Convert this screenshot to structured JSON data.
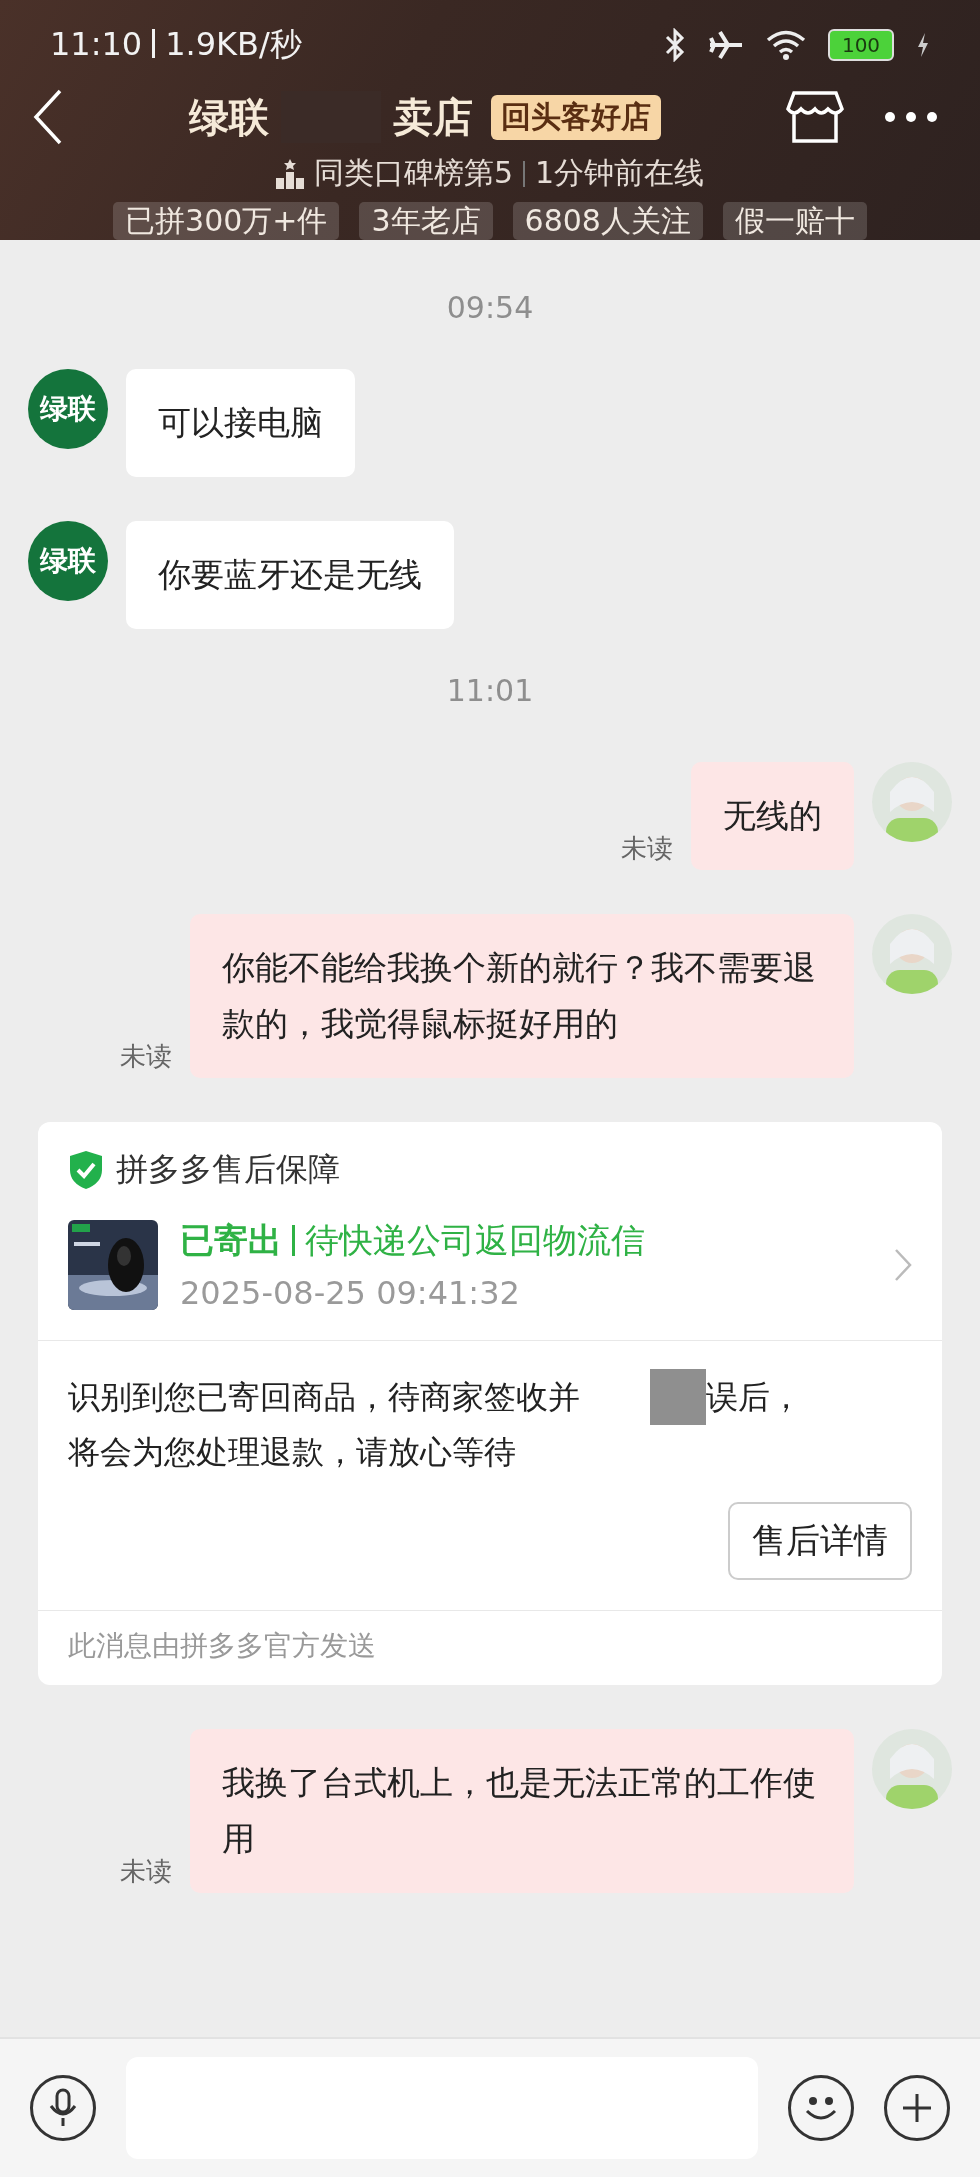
{
  "status_bar": {
    "time": "11:10",
    "speed": "1.9KB/秒",
    "battery": "100"
  },
  "header": {
    "title_parts": [
      "绿联",
      "卖店"
    ],
    "badge": "回头客好店",
    "rank": "同类口碑榜第5",
    "online": "1分钟前在线",
    "tags": [
      "已拼300万+件",
      "3年老店",
      "6808人关注",
      "假一赔十"
    ]
  },
  "messages": [
    {
      "kind": "time",
      "text": "09:54"
    },
    {
      "kind": "received",
      "avatar": "绿联",
      "text": "可以接电脑"
    },
    {
      "kind": "received",
      "avatar": "绿联",
      "text": "你要蓝牙还是无线"
    },
    {
      "kind": "time",
      "text": "11:01"
    },
    {
      "kind": "sent",
      "status": "未读",
      "text": "无线的"
    },
    {
      "kind": "sent",
      "status": "未读",
      "text": "你能不能给我换个新的就行？我不需要退款的，我觉得鼠标挺好用的"
    },
    {
      "kind": "card",
      "title": "拼多多售后保障",
      "state": "已寄出",
      "progress": "待快递公司返回物流信",
      "date": "2025-08-25 09:41:32",
      "body_parts": [
        "识别到您已寄回商品，待商家签收并",
        "误后，"
      ],
      "body_rest": "将会为您处理退款，请放心等待",
      "button": "售后详情",
      "footer": "此消息由拼多多官方发送"
    },
    {
      "kind": "sent",
      "status": "未读",
      "text": "我换了台式机上，也是无法正常的工作使用"
    }
  ]
}
